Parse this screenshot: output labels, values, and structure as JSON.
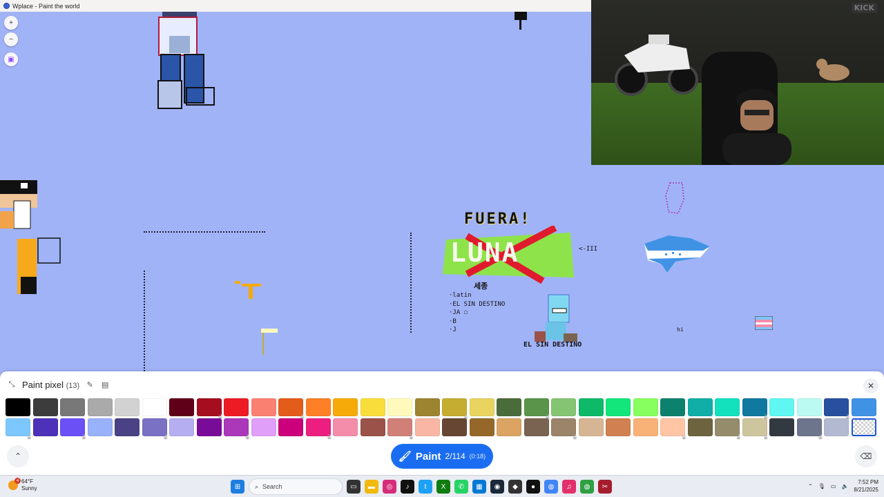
{
  "browser": {
    "tab_title": "Wplace - Paint the world"
  },
  "map": {
    "zoom_in": "+",
    "zoom_out": "−",
    "artwork_text": {
      "fuera": "FUERA!",
      "luna_strike": "LUNA",
      "arrow_label": "<-III",
      "korean": "세종",
      "list_items": [
        "·latin",
        "·EL SIN DESTINO",
        "·JA  ☐",
        "·B",
        "·J"
      ],
      "el_sin_destino": "EL SIN DESTINO",
      "hi": "hi"
    }
  },
  "webcam": {
    "brand": "KICK"
  },
  "paint_panel": {
    "title": "Paint pixel",
    "count": "(13)",
    "paint_label": "Paint",
    "paint_progress": "2/114",
    "paint_timer": "(0:18)",
    "palette_row1": [
      "#000000",
      "#3c3c3c",
      "#787878",
      "#aaaaaa",
      "#d2d2d2",
      "#ffffff",
      "#600018",
      "#a50e1e",
      "#ed1c24",
      "#fa8072",
      "#e45c1a",
      "#ff7f27",
      "#f6aa09",
      "#f9dd3b",
      "#fffabc",
      "#9c8431",
      "#c5ad31",
      "#e8d45f",
      "#4a6b3a",
      "#5a944a",
      "#84c573",
      "#0eb968",
      "#13e67b",
      "#87ff5e",
      "#0c816e",
      "#10aea6",
      "#13e1be",
      "#0f799f",
      "#60f7f2",
      "#bbfaf2",
      "#28509e",
      "#4093e4"
    ],
    "palette_row2": [
      "#7dc7ff",
      "#4d31b8",
      "#6b50f6",
      "#99b1fb",
      "#4a4284",
      "#7a71c4",
      "#b5aef1",
      "#780c99",
      "#aa38b9",
      "#e09ff9",
      "#cb007a",
      "#ec1f80",
      "#f38da9",
      "#9b5249",
      "#d18078",
      "#fab6a4",
      "#684634",
      "#95682a",
      "#dba463",
      "#7b6352",
      "#9c846b",
      "#d6b594",
      "#d18051",
      "#f8b277",
      "#ffc5a5",
      "#6d643f",
      "#948c6b",
      "#cdc59e",
      "#333941",
      "#6d758d",
      "#b3b9d1",
      "transparent"
    ],
    "locked_row1": [
      false,
      false,
      false,
      false,
      false,
      false,
      false,
      true,
      false,
      false,
      true,
      false,
      false,
      false,
      false,
      false,
      true,
      false,
      false,
      true,
      false,
      false,
      false,
      false,
      false,
      false,
      false,
      true,
      false,
      false,
      true,
      false
    ],
    "locked_row2": [
      true,
      false,
      true,
      false,
      false,
      true,
      false,
      false,
      true,
      false,
      false,
      true,
      false,
      false,
      true,
      false,
      false,
      false,
      false,
      false,
      true,
      false,
      false,
      false,
      true,
      false,
      true,
      true,
      false,
      true,
      false,
      false
    ]
  },
  "taskbar": {
    "weather_temp": "64°F",
    "weather_desc": "Sunny",
    "weather_badge": "4",
    "search_placeholder": "Search",
    "time": "7:52 PM",
    "date": "8/21/2025"
  }
}
